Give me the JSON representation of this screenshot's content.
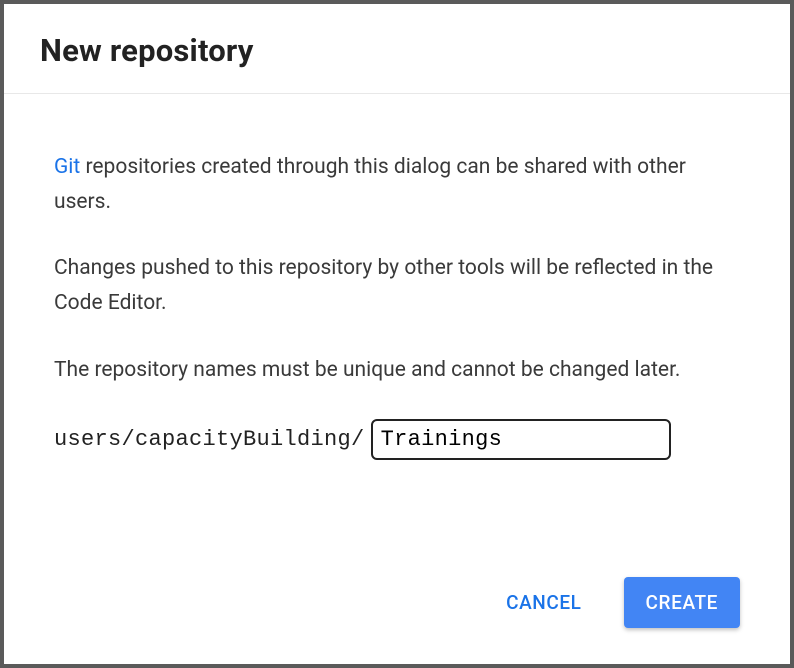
{
  "dialog": {
    "title": "New repository",
    "link_text": "Git",
    "paragraph1_rest": " repositories created through this dialog can be shared with other users.",
    "paragraph2": "Changes pushed to this repository by other tools will be reflected in the Code Editor.",
    "paragraph3": "The repository names must be unique and cannot be changed later.",
    "path_prefix": "users/capacityBuilding/",
    "repo_name_value": "Trainings",
    "cancel_label": "CANCEL",
    "create_label": "CREATE"
  }
}
